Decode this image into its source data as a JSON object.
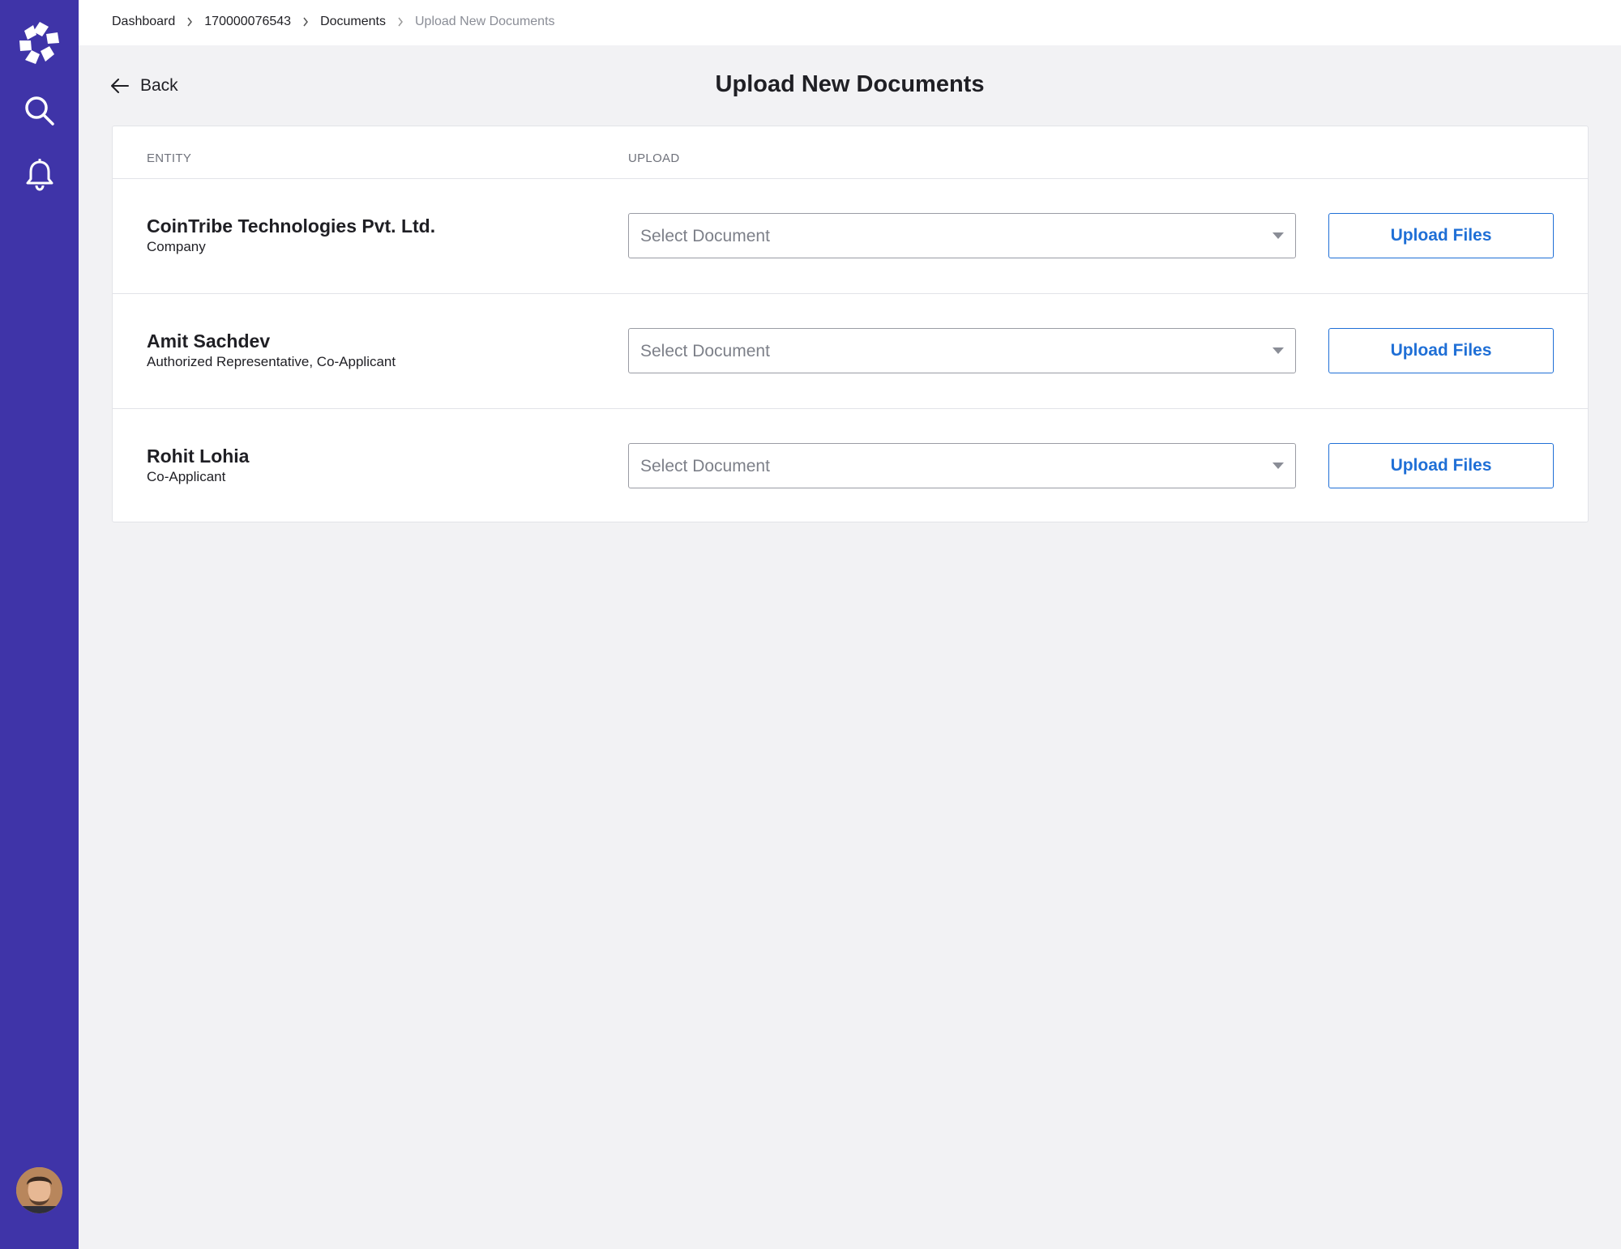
{
  "breadcrumb": {
    "items": [
      {
        "label": "Dashboard"
      },
      {
        "label": "170000076543"
      },
      {
        "label": "Documents"
      },
      {
        "label": "Upload New Documents"
      }
    ]
  },
  "back_label": "Back",
  "page_title": "Upload New Documents",
  "table": {
    "columns": {
      "entity": "ENTITY",
      "upload": "UPLOAD"
    },
    "rows": [
      {
        "name": "CoinTribe Technologies Pvt. Ltd.",
        "role": "Company",
        "select_placeholder": "Select Document",
        "button_label": "Upload Files"
      },
      {
        "name": "Amit Sachdev",
        "role": "Authorized Representative, Co-Applicant",
        "select_placeholder": "Select Document",
        "button_label": "Upload Files"
      },
      {
        "name": "Rohit Lohia",
        "role": "Co-Applicant",
        "select_placeholder": "Select Document",
        "button_label": "Upload Files"
      }
    ]
  },
  "colors": {
    "sidebar": "#3f34a8",
    "accent": "#1f6fd6",
    "background": "#f2f2f4"
  },
  "icons": {
    "sidebar": [
      "logo-icon",
      "search-icon",
      "bell-icon"
    ],
    "back": "arrow-left-icon",
    "select": "caret-down-icon"
  }
}
